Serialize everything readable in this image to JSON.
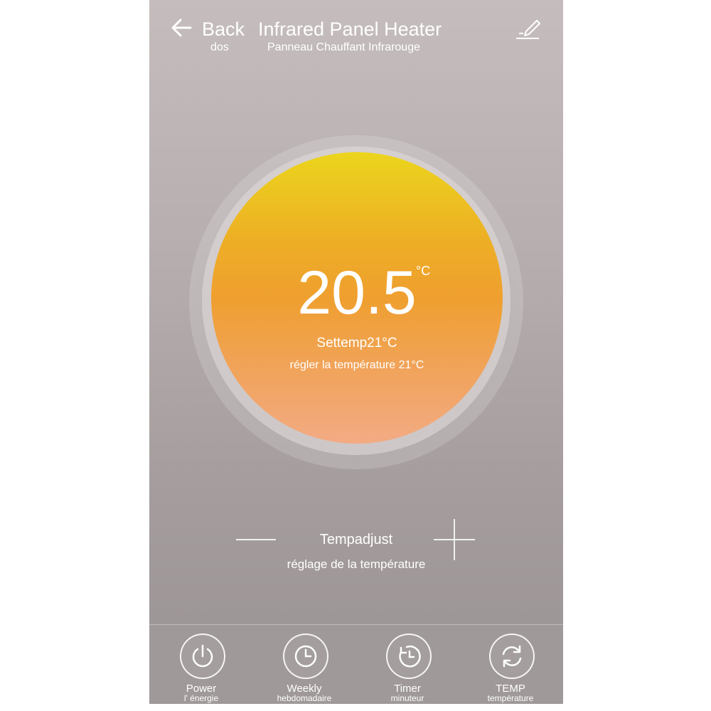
{
  "header": {
    "back_label": "Back",
    "back_sub": "dos",
    "title": "Infrared Panel Heater",
    "title_sub": "Panneau Chauffant Infrarouge",
    "edit_icon": "pencil-edit-icon"
  },
  "dial": {
    "current_temp": "20.5",
    "unit": "°C",
    "settemp": "Settemp21°C",
    "settemp_sub": "régler la température 21°C",
    "colors": {
      "top": "#ecd51d",
      "middle": "#ef9f2f",
      "bottom": "#f3ab84"
    }
  },
  "adjust": {
    "label": "Tempadjust",
    "sub": "réglage de la température",
    "minus_icon": "minus-icon",
    "plus_icon": "plus-icon"
  },
  "nav": {
    "items": [
      {
        "label": "Power",
        "sub": "l' énergie",
        "icon": "power-icon"
      },
      {
        "label": "Weekly",
        "sub": "hebdomadaire",
        "icon": "clock-icon"
      },
      {
        "label": "Timer",
        "sub": "minuteur",
        "icon": "timer-icon"
      },
      {
        "label": "TEMP",
        "sub": "température",
        "icon": "refresh-icon"
      }
    ]
  }
}
